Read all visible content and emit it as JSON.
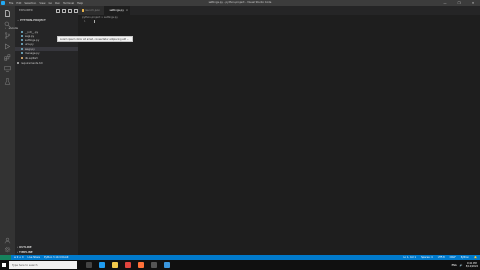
{
  "titlebar": {
    "menu": [
      "File",
      "Edit",
      "Selection",
      "View",
      "Go",
      "Run",
      "Terminal",
      "Help"
    ],
    "title": "settings.py - python-project - Visual Studio Code",
    "controls": [
      "—",
      "❐",
      "✕"
    ]
  },
  "sidebar": {
    "title": "EXPLORER",
    "section": "PYTHON-PROJECT",
    "items": [
      {
        "label": ".vscode",
        "kind": "folder"
      },
      {
        "label": "__init__.py",
        "kind": "file"
      },
      {
        "label": "asgi.py",
        "kind": "file"
      },
      {
        "label": "settings.py",
        "kind": "file"
      },
      {
        "label": "urls.py",
        "kind": "file"
      },
      {
        "label": "wsgi.py",
        "kind": "file"
      },
      {
        "label": "manage.py",
        "kind": "file"
      },
      {
        "label": "db.sqlite3",
        "kind": "file"
      },
      {
        "label": "requirements.txt",
        "kind": "file"
      }
    ],
    "outline": "OUTLINE",
    "timeline": "TIMELINE"
  },
  "tabs": [
    {
      "label": "launch.json",
      "active": false
    },
    {
      "label": "settings.py",
      "active": true
    }
  ],
  "breadcrumb": "python-project > settings.py",
  "editor": {
    "line_number": "1",
    "tooltip": "Lorem ipsum dolor sit amet, consectetur adipiscing elit ..."
  },
  "statusbar": {
    "left": [
      "⊗ 0 ⚠ 0",
      "Live Share",
      "Python 3.10.4 64-bit"
    ],
    "right": [
      "Ln 1, Col 1",
      "Spaces: 4",
      "UTF-8",
      "CRLF",
      "Python",
      "🔔"
    ]
  },
  "taskbar": {
    "search_placeholder": "Type here to search",
    "apps": [
      {
        "name": "task-view",
        "color": "#444444"
      },
      {
        "name": "vscode",
        "color": "#1f9cf0"
      },
      {
        "name": "explorer",
        "color": "#f2c94c"
      },
      {
        "name": "chrome",
        "color": "#e0443e"
      },
      {
        "name": "firefox",
        "color": "#ff7139"
      },
      {
        "name": "terminal",
        "color": "#555555"
      },
      {
        "name": "settings",
        "color": "#3a96dd"
      }
    ],
    "tray": [
      "ENG",
      "🔊"
    ],
    "time": "9:41 PM",
    "date": "5/12/2022"
  },
  "colors": {
    "accent": "#007acc",
    "activitybar": "#333333",
    "sidebar": "#252526",
    "editor": "#1e1e1e"
  }
}
